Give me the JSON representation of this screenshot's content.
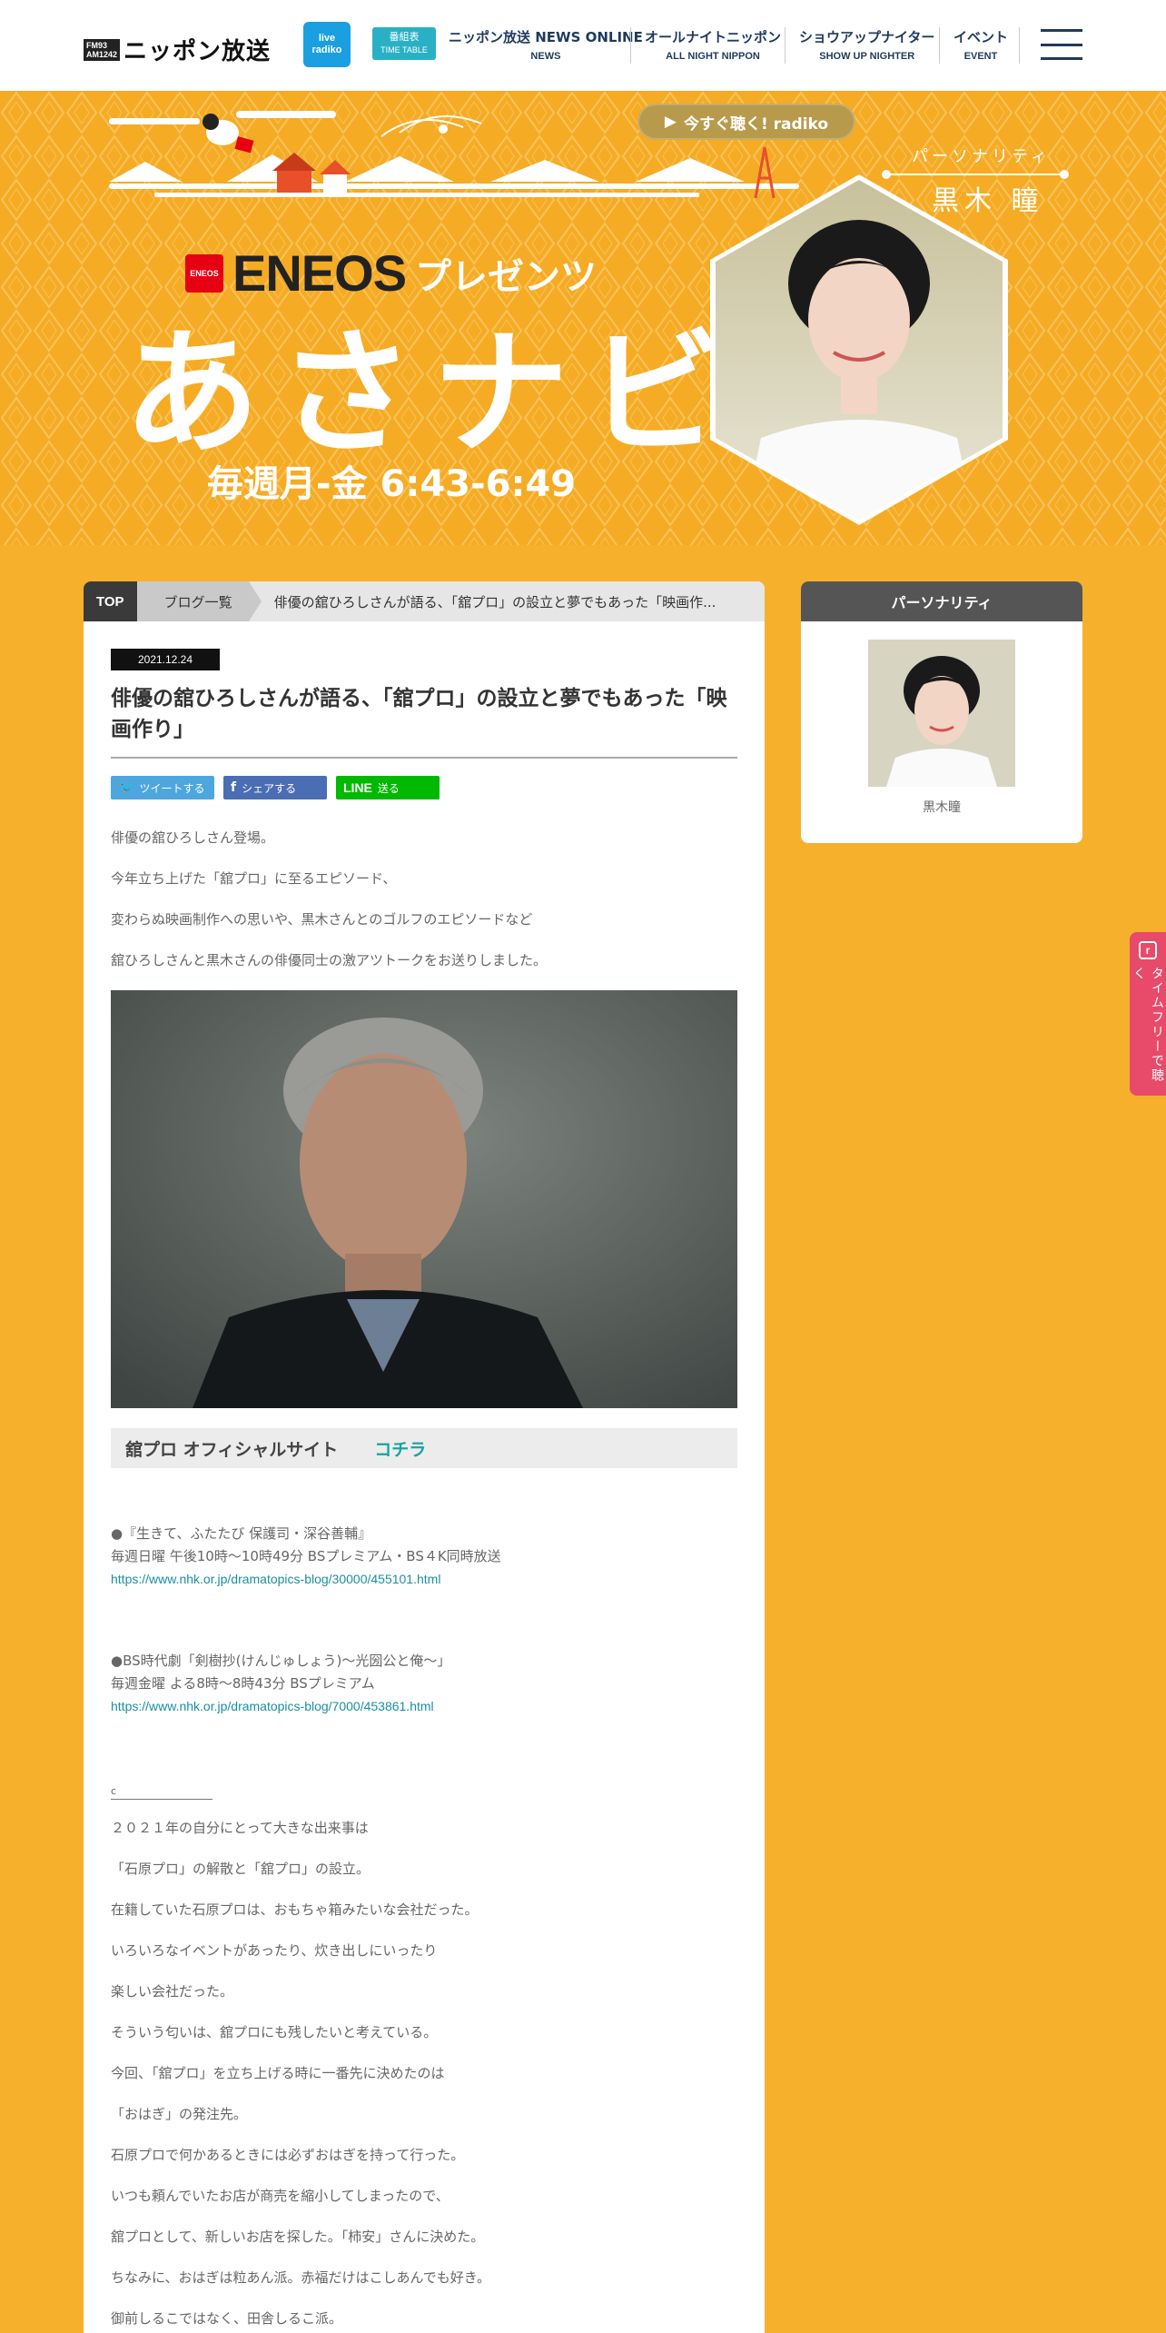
{
  "header": {
    "brand_fm": "FM93",
    "brand_am": "AM1242",
    "brand_name": "ニッポン放送",
    "radiko_live": "live",
    "radiko_label": "radiko",
    "timetable_main": "番組表",
    "timetable_sub": "TIME TABLE",
    "nav": [
      {
        "label": "ニッポン放送 NEWS ONLINE",
        "sub": "NEWS"
      },
      {
        "label": "オールナイトニッポン",
        "sub": "ALL NIGHT NIPPON"
      },
      {
        "label": "ショウアップナイター",
        "sub": "SHOW UP NIGHTER"
      },
      {
        "label": "イベント",
        "sub": "EVENT"
      }
    ],
    "menu_icon": "hamburger-icon"
  },
  "hero": {
    "radiko_button": "今すぐ聴く! radiko",
    "sponsor_mark": "ENEOS",
    "sponsor_name": "ENEOS",
    "sponsor_presents": "プレゼンツ",
    "show_title": "あさナビ",
    "schedule": "毎週月-金 6:43-6:49",
    "personality_label": "パーソナリティ",
    "personality_name": "黒木 瞳",
    "accent_color": "#f5ab24"
  },
  "breadcrumb": {
    "top": "TOP",
    "list": "ブログ一覧",
    "current": "俳優の舘ひろしさんが語る、「舘プロ」の設立と夢でもあった「映画作..."
  },
  "post": {
    "date": "2021.12.24",
    "title": "俳優の舘ひろしさんが語る、「舘プロ」の設立と夢でもあった「映画作り」",
    "share": {
      "tweet": "ツイートする",
      "facebook": "シェアする",
      "line_brand": "LINE",
      "line": "送る"
    },
    "intro": [
      "俳優の舘ひろしさん登場。",
      "今年立ち上げた「舘プロ」に至るエピソード、",
      "変わらぬ映画制作への思いや、黒木さんとのゴルフのエピソードなど",
      "舘ひろしさんと黒木さんの俳優同士の激アツトークをお送りしました。"
    ],
    "office_label": "舘プロ オフィシャルサイト",
    "office_link": "コチラ",
    "info1": {
      "title": "●『生きて、ふたたび 保護司・深谷善輔』",
      "time": "毎週日曜 午後10時～10時49分 BSプレミアム・BS４K同時放送",
      "url": "https://www.nhk.or.jp/dramatopics-blog/30000/455101.html"
    },
    "info2": {
      "title": "●BS時代劇「剣樹抄(けんじゅしょう)～光圀公と俺～」",
      "time": "毎週金曜 よる8時～8時43分 BSプレミアム",
      "url": "https://www.nhk.or.jp/dramatopics-blog/7000/453861.html"
    },
    "separator": "c",
    "essay": [
      "２０２１年の自分にとって大きな出来事は",
      "「石原プロ」の解散と「舘プロ」の設立。",
      "在籍していた石原プロは、おもちゃ箱みたいな会社だった。",
      "いろいろなイベントがあったり、炊き出しにいったり",
      "楽しい会社だった。",
      "そういう匂いは、舘プロにも残したいと考えている。",
      "今回、「舘プロ」を立ち上げる時に一番先に決めたのは",
      "「おはぎ」の発注先。",
      "石原プロで何かあるときには必ずおはぎを持って行った。",
      "いつも頼んでいたお店が商売を縮小してしまったので、",
      "舘プロとして、新しいお店を探した。「柿安」さんに決めた。",
      "ちなみに、おはぎは粒あん派。赤福だけはこしあんでも好き。",
      "御前しるこではなく、田舎しるこ派。"
    ]
  },
  "sidebar": {
    "heading": "パーソナリティ",
    "name": "黒木瞳"
  },
  "floating_tab": {
    "icon": "r",
    "label": "タイムフリーで聴く"
  }
}
